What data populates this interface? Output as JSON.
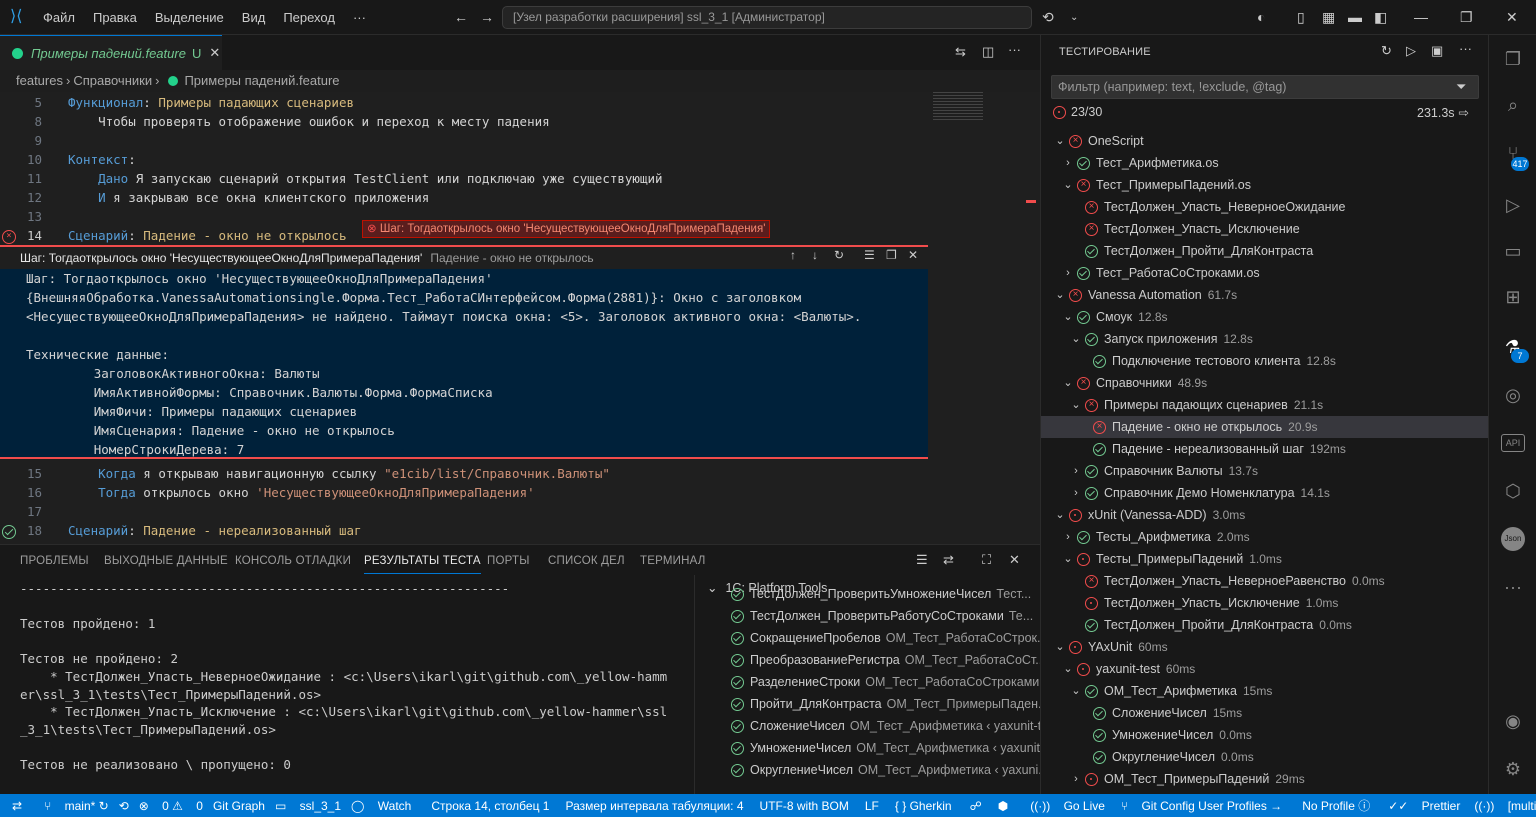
{
  "titlebar": {
    "menu": [
      "Файл",
      "Правка",
      "Выделение",
      "Вид",
      "Переход",
      "···"
    ],
    "command_center": "[Узел разработки расширения] ssl_3_1 [Администратор]"
  },
  "editor": {
    "tab_label": "Примеры падений.feature",
    "tab_status": "U",
    "breadcrumb": [
      "features",
      "Справочники",
      "Примеры падений.feature"
    ],
    "lines": [
      {
        "n": "5",
        "parts": [
          {
            "c": "kw",
            "t": "Функционал"
          },
          {
            "c": "txt",
            "t": ": "
          },
          {
            "c": "nm",
            "t": "Примеры падающих сценариев"
          }
        ]
      },
      {
        "n": "8",
        "parts": [
          {
            "c": "txt",
            "t": "    Чтобы проверять отображение ошибок и переход к месту падения"
          }
        ]
      },
      {
        "n": "9",
        "parts": []
      },
      {
        "n": "10",
        "parts": [
          {
            "c": "kw",
            "t": "Контекст"
          },
          {
            "c": "txt",
            "t": ":"
          }
        ]
      },
      {
        "n": "11",
        "parts": [
          {
            "c": "txt",
            "t": "    "
          },
          {
            "c": "kw",
            "t": "Дано"
          },
          {
            "c": "txt",
            "t": " Я запускаю сценарий открытия TestClient или подключаю уже существующий"
          }
        ]
      },
      {
        "n": "12",
        "parts": [
          {
            "c": "txt",
            "t": "    "
          },
          {
            "c": "kw",
            "t": "И"
          },
          {
            "c": "txt",
            "t": " я закрываю все окна клиентского приложения"
          }
        ]
      },
      {
        "n": "13",
        "parts": []
      },
      {
        "n": "14",
        "parts": [
          {
            "c": "kw",
            "t": "Сценарий"
          },
          {
            "c": "txt",
            "t": ": "
          },
          {
            "c": "nm",
            "t": "Падение - окно не открылось"
          }
        ]
      }
    ],
    "inline_error": "Шаг: Тогдаоткрылось окно 'НесуществующееОкноДляПримераПадения'",
    "peek": {
      "title": "Шаг: Тогдаоткрылось окно 'НесуществующееОкноДляПримераПадения'",
      "subtitle": "Падение - окно не открылось",
      "lines": [
        "Шаг: Тогдаоткрылось окно 'НесуществующееОкноДляПримераПадения'",
        "{ВнешняяОбработка.VanessaAutomationsingle.Форма.Тест_РаботаСИнтерфейсом.Форма(2881)}: Окно с заголовком",
        "<НесуществующееОкноДляПримераПадения> не найдено. Таймаут поиска окна: <5>. Заголовок активного окна: <Валюты>.",
        "",
        "Технические данные:",
        "         ЗаголовокАктивногоОкна: Валюты",
        "         ИмяАктивнойФормы: Справочник.Валюты.Форма.ФормаСписка",
        "         ИмяФичи: Примеры падающих сценариев",
        "         ИмяСценария: Падение - окно не открылось",
        "         НомерСтрокиДерева: 7"
      ]
    },
    "lines_after": [
      {
        "n": "15",
        "parts": [
          {
            "c": "txt",
            "t": "    "
          },
          {
            "c": "kw",
            "t": "Когда"
          },
          {
            "c": "txt",
            "t": " я открываю навигационную ссылку "
          },
          {
            "c": "str",
            "t": "\"e1cib/list/Справочник.Валюты\""
          }
        ]
      },
      {
        "n": "16",
        "parts": [
          {
            "c": "txt",
            "t": "    "
          },
          {
            "c": "kw",
            "t": "Тогда"
          },
          {
            "c": "txt",
            "t": " открылось окно "
          },
          {
            "c": "str",
            "t": "'НесуществующееОкноДляПримераПадения'"
          }
        ]
      },
      {
        "n": "17",
        "parts": []
      },
      {
        "n": "18",
        "parts": [
          {
            "c": "kw",
            "t": "Сценарий"
          },
          {
            "c": "txt",
            "t": ": "
          },
          {
            "c": "nm",
            "t": "Падение - нереализованный шаг"
          }
        ]
      }
    ]
  },
  "panel": {
    "tabs": [
      "ПРОБЛЕМЫ",
      "ВЫХОДНЫЕ ДАННЫЕ",
      "КОНСОЛЬ ОТЛАДКИ",
      "РЕЗУЛЬТАТЫ ТЕСТА",
      "ПОРТЫ",
      "СПИСОК ДЕЛ",
      "ТЕРМИНАЛ"
    ],
    "active_tab": "РЕЗУЛЬТАТЫ ТЕСТА",
    "terminal": [
      "-----------------------------------------------------------------",
      "",
      "Тестов пройдено: 1",
      "",
      "Тестов не пройдено: 2",
      "    * ТестДолжен_Упасть_НеверноеОжидание : <c:\\Users\\ikarl\\git\\github.com\\_yellow-hamm",
      "er\\ssl_3_1\\tests\\Тест_ПримерыПадений.os>",
      "    * ТестДолжен_Упасть_Исключение : <c:\\Users\\ikarl\\git\\github.com\\_yellow-hammer\\ssl",
      "_3_1\\tests\\Тест_ПримерыПадений.os>",
      "",
      "Тестов не реализовано \\ пропущено: 0"
    ],
    "side_title": "1С: Platform Tools",
    "side_items": [
      {
        "name": "ТестДолжен_ПроверитьУмножениеЧисел",
        "desc": "Тест..."
      },
      {
        "name": "ТестДолжен_ПроверитьРаботуСоСтроками",
        "desc": "Те..."
      },
      {
        "name": "СокращениеПробелов",
        "desc": "ОМ_Тест_РаботаСоСтрок..."
      },
      {
        "name": "ПреобразованиеРегистра",
        "desc": "ОМ_Тест_РаботаСоСт..."
      },
      {
        "name": "РазделениеСтроки",
        "desc": "ОМ_Тест_РаботаСоСтроками ..."
      },
      {
        "name": "Пройти_ДляКонтраста",
        "desc": "ОМ_Тест_ПримерыПаден..."
      },
      {
        "name": "СложениеЧисел",
        "desc": "ОМ_Тест_Арифметика ‹ yaxunit-t..."
      },
      {
        "name": "УмножениеЧисел",
        "desc": "ОМ_Тест_Арифметика ‹ yaxunit..."
      },
      {
        "name": "ОкруглениеЧисел",
        "desc": "ОМ_Тест_Арифметика ‹ yaxuni..."
      }
    ]
  },
  "testing": {
    "title": "ТЕСТИРОВАНИЕ",
    "filter_placeholder": "Фильтр (например: text, !exclude, @tag)",
    "summary": "23/30",
    "total_time": "231.3s",
    "tree": [
      {
        "d": 0,
        "chev": "v",
        "st": "err",
        "label": "OneScript",
        "dur": ""
      },
      {
        "d": 1,
        "chev": ">",
        "st": "ok",
        "label": "Тест_Арифметика.os",
        "dur": ""
      },
      {
        "d": 1,
        "chev": "v",
        "st": "err",
        "label": "Тест_ПримерыПадений.os",
        "dur": ""
      },
      {
        "d": 2,
        "chev": "",
        "st": "err",
        "label": "ТестДолжен_Упасть_НеверноеОжидание",
        "dur": ""
      },
      {
        "d": 2,
        "chev": "",
        "st": "err",
        "label": "ТестДолжен_Упасть_Исключение",
        "dur": ""
      },
      {
        "d": 2,
        "chev": "",
        "st": "ok",
        "label": "ТестДолжен_Пройти_ДляКонтраста",
        "dur": ""
      },
      {
        "d": 1,
        "chev": ">",
        "st": "ok",
        "label": "Тест_РаботаСоСтроками.os",
        "dur": ""
      },
      {
        "d": 0,
        "chev": "v",
        "st": "err",
        "label": "Vanessa Automation",
        "dur": "61.7s"
      },
      {
        "d": 1,
        "chev": "v",
        "st": "ok",
        "label": "Смоук",
        "dur": "12.8s"
      },
      {
        "d": 2,
        "chev": "v",
        "st": "ok",
        "label": "Запуск приложения",
        "dur": "12.8s"
      },
      {
        "d": 3,
        "chev": "",
        "st": "ok",
        "label": "Подключение тестового клиента",
        "dur": "12.8s"
      },
      {
        "d": 1,
        "chev": "v",
        "st": "err",
        "label": "Справочники",
        "dur": "48.9s"
      },
      {
        "d": 2,
        "chev": "v",
        "st": "err",
        "label": "Примеры падающих сценариев",
        "dur": "21.1s"
      },
      {
        "d": 3,
        "chev": "",
        "st": "err",
        "label": "Падение - окно не открылось",
        "dur": "20.9s",
        "sel": true
      },
      {
        "d": 3,
        "chev": "",
        "st": "ok",
        "label": "Падение - нереализованный шаг",
        "dur": "192ms"
      },
      {
        "d": 2,
        "chev": ">",
        "st": "ok",
        "label": "Справочник Валюты",
        "dur": "13.7s"
      },
      {
        "d": 2,
        "chev": ">",
        "st": "ok",
        "label": "Справочник Демо Номенклатура",
        "dur": "14.1s"
      },
      {
        "d": 0,
        "chev": "v",
        "st": "skip",
        "label": "xUnit (Vanessa-ADD)",
        "dur": "3.0ms"
      },
      {
        "d": 1,
        "chev": ">",
        "st": "ok",
        "label": "Тесты_Арифметика",
        "dur": "2.0ms"
      },
      {
        "d": 1,
        "chev": "v",
        "st": "skip",
        "label": "Тесты_ПримерыПадений",
        "dur": "1.0ms"
      },
      {
        "d": 2,
        "chev": "",
        "st": "err",
        "label": "ТестДолжен_Упасть_НеверноеРавенство",
        "dur": "0.0ms"
      },
      {
        "d": 2,
        "chev": "",
        "st": "skip",
        "label": "ТестДолжен_Упасть_Исключение",
        "dur": "1.0ms"
      },
      {
        "d": 2,
        "chev": "",
        "st": "ok",
        "label": "ТестДолжен_Пройти_ДляКонтраста",
        "dur": "0.0ms"
      },
      {
        "d": 0,
        "chev": "v",
        "st": "skip",
        "label": "YAxUnit",
        "dur": "60ms"
      },
      {
        "d": 1,
        "chev": "v",
        "st": "skip",
        "label": "yaxunit-test",
        "dur": "60ms"
      },
      {
        "d": 2,
        "chev": "v",
        "st": "ok",
        "label": "ОМ_Тест_Арифметика",
        "dur": "15ms"
      },
      {
        "d": 3,
        "chev": "",
        "st": "ok",
        "label": "СложениеЧисел",
        "dur": "15ms"
      },
      {
        "d": 3,
        "chev": "",
        "st": "ok",
        "label": "УмножениеЧисел",
        "dur": "0.0ms"
      },
      {
        "d": 3,
        "chev": "",
        "st": "ok",
        "label": "ОкруглениеЧисел",
        "dur": "0.0ms"
      },
      {
        "d": 2,
        "chev": ">",
        "st": "skip",
        "label": "ОМ_Тест_ПримерыПадений",
        "dur": "29ms"
      }
    ]
  },
  "activity": {
    "badges": {
      "scm": "417",
      "testing": "7"
    },
    "api_label": "API",
    "json_label": "Json"
  },
  "statusbar": {
    "branch": "main*",
    "problems_err": "0",
    "problems_warn": "0",
    "items": [
      "Git Graph",
      "ssl_3_1",
      "Watch",
      "Строка 14, столбец 1",
      "Размер интервала табуляции: 4",
      "UTF-8 with BOM",
      "LF",
      "{ } Gherkin",
      "Go Live",
      "Git Config User Profiles",
      "No Profile",
      "Prettier",
      "[multi]"
    ]
  },
  "colors": {
    "accent": "#0078d4",
    "error": "#f14c4c",
    "pass": "#73c991"
  }
}
